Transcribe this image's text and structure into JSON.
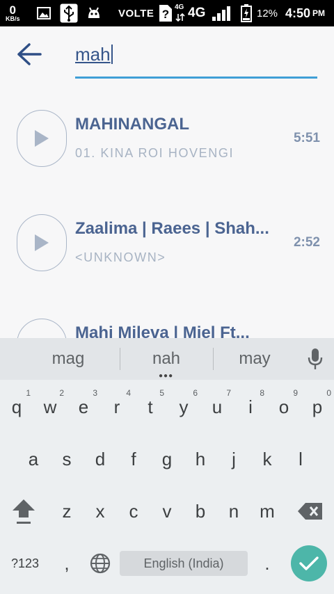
{
  "status_bar": {
    "speed_value": "0",
    "speed_unit": "KB/s",
    "volte": "VOLTE",
    "network_small": "4G",
    "network": "4G",
    "battery_pct": "12%",
    "time": "4:50",
    "ampm": "PM",
    "icons": [
      "image-icon",
      "usb-icon",
      "android-icon",
      "no-sim-icon",
      "data-arrows-icon",
      "signal-icon",
      "battery-charging-icon"
    ]
  },
  "search": {
    "query": "mah"
  },
  "results": [
    {
      "title": "MAHINANGAL",
      "subtitle": "01. KINA ROI HOVENGI",
      "duration": "5:51"
    },
    {
      "title": "Zaalima | Raees | Shah...",
      "subtitle": "<UNKNOWN>",
      "duration": "2:52"
    },
    {
      "title": "Mahi Mileva | Miel Ft...",
      "subtitle": "",
      "duration": ""
    }
  ],
  "keyboard": {
    "suggestions": [
      "mag",
      "nah",
      "may"
    ],
    "row1": [
      "q",
      "w",
      "e",
      "r",
      "t",
      "y",
      "u",
      "i",
      "o",
      "p"
    ],
    "row1_hints": [
      "1",
      "2",
      "3",
      "4",
      "5",
      "6",
      "7",
      "8",
      "9",
      "0"
    ],
    "row2": [
      "a",
      "s",
      "d",
      "f",
      "g",
      "h",
      "j",
      "k",
      "l"
    ],
    "row3": [
      "z",
      "x",
      "c",
      "v",
      "b",
      "n",
      "m"
    ],
    "symbols_label": "?123",
    "comma": ",",
    "period": ".",
    "space_label": "English (India)"
  },
  "colors": {
    "accent": "#3f9fd6",
    "title": "#4b6491",
    "enter": "#4db6a9"
  }
}
